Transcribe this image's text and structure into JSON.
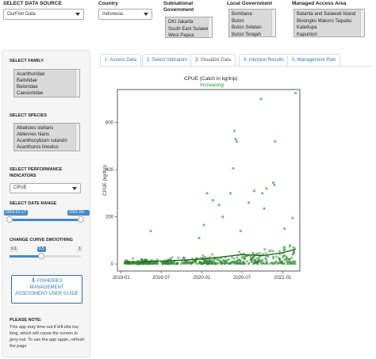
{
  "filters": {
    "data_source": {
      "label": "SELECT DATA SOURCE",
      "value": "OurFish Data"
    },
    "country": {
      "label": "Country",
      "value": "Indonesia"
    },
    "subnational": {
      "label": "Subnational Government",
      "items": [
        "DKI Jakarta",
        "South East Sulawesi",
        "West Papua"
      ]
    },
    "local_gov": {
      "label": "Local Government",
      "items": [
        "Bombana",
        "Buton",
        "Buton Selatan",
        "Buton Tengah"
      ]
    },
    "managed_access": {
      "label": "Managed Access Area",
      "items": [
        "Batanta and Salawati Island",
        "Binongko Makoro Taipabu",
        "Kaledupa",
        "Kapuntori"
      ]
    }
  },
  "sidebar": {
    "family": {
      "label": "SELECT FAMILY",
      "items": [
        "Acanthuridae",
        "Balistidae",
        "Belonidae",
        "Caesionidae"
      ]
    },
    "species": {
      "label": "SELECT SPECIES",
      "items": [
        "Abalistes stellaris",
        "Ablennes hians",
        "Acanthocybium solandri",
        "Acanthurus lineatus"
      ]
    },
    "indicators": {
      "label_line1": "SELECT PERFORMANCE",
      "label_line2": "INDICATORS",
      "value": "CPUE"
    },
    "date_range": {
      "label": "SELECT DATE RANGE",
      "start": "2019-01-17",
      "end": "2021-03-01"
    },
    "smoothing": {
      "label": "CHANGE CURVE SMOOTHING",
      "min": "0.1",
      "value": "0.5",
      "max": "1",
      "level": 0.44
    },
    "guide": {
      "icon": "download-icon",
      "line1": "FISHERIES",
      "line2": "MANAGEMENT",
      "line3": "ASSESSMENT USER GUIDE"
    },
    "note": {
      "title": "PLEASE NOTE:",
      "text": "This app may time-out if left idle too long, which will cause the screen to grey-out. To use the app again, refresh the page"
    }
  },
  "tabs": [
    {
      "label": "1. Assess Data"
    },
    {
      "label": "2. Select Indicators"
    },
    {
      "label": "3. Visualize Data"
    },
    {
      "label": "4. Interpret Results"
    },
    {
      "label": "5. Management Plan"
    }
  ],
  "plot": {
    "title": "CPUE (Catch in kg/trip)",
    "subtitle": "Increasing"
  },
  "chart_data": {
    "type": "scatter",
    "title": "CPUE (Catch in kg/trip)",
    "subtitle": "Increasing",
    "xlabel": "",
    "ylabel": "CPUE (kg/trip)",
    "xlim": [
      "2018-12-15",
      "2021-03-20"
    ],
    "ylim": [
      -30,
      740
    ],
    "x_ticks": [
      "2019-01",
      "2019-07",
      "2020-01",
      "2020-07",
      "2021-01"
    ],
    "y_ticks": [
      0,
      200,
      400,
      600
    ],
    "colors": {
      "points": "#2e8b2e",
      "trend": "#1a6b1a"
    },
    "outliers": [
      {
        "x": "2019-05-15",
        "y": 140
      },
      {
        "x": "2020-01-25",
        "y": 300
      },
      {
        "x": "2020-02-20",
        "y": 270
      },
      {
        "x": "2020-03-20",
        "y": 250
      },
      {
        "x": "2020-05-10",
        "y": 300
      },
      {
        "x": "2020-05-28",
        "y": 565
      },
      {
        "x": "2020-06-02",
        "y": 530
      },
      {
        "x": "2020-06-08",
        "y": 520
      },
      {
        "x": "2020-06-25",
        "y": 140
      },
      {
        "x": "2020-08-01",
        "y": 260
      },
      {
        "x": "2020-08-25",
        "y": 310
      },
      {
        "x": "2020-09-25",
        "y": 700
      },
      {
        "x": "2020-10-01",
        "y": 300
      },
      {
        "x": "2020-10-10",
        "y": 235
      },
      {
        "x": "2020-10-20",
        "y": 320
      },
      {
        "x": "2020-11-20",
        "y": 345
      },
      {
        "x": "2020-11-25",
        "y": 335
      },
      {
        "x": "2020-11-28",
        "y": 520
      },
      {
        "x": "2021-01-10",
        "y": 150
      },
      {
        "x": "2021-02-15",
        "y": 195
      },
      {
        "x": "2021-03-01",
        "y": 725
      },
      {
        "x": "2020-04-05",
        "y": 200
      },
      {
        "x": "2020-05-22",
        "y": 405
      },
      {
        "x": "2020-01-10",
        "y": 165
      },
      {
        "x": "2019-12-20",
        "y": 110
      }
    ],
    "trend": [
      {
        "x": "2019-01-17",
        "y": 8
      },
      {
        "x": "2019-07-01",
        "y": 12
      },
      {
        "x": "2020-01-01",
        "y": 20
      },
      {
        "x": "2020-04-01",
        "y": 30
      },
      {
        "x": "2020-07-01",
        "y": 40
      },
      {
        "x": "2020-10-01",
        "y": 35
      },
      {
        "x": "2021-01-01",
        "y": 48
      },
      {
        "x": "2021-03-01",
        "y": 62
      }
    ]
  }
}
